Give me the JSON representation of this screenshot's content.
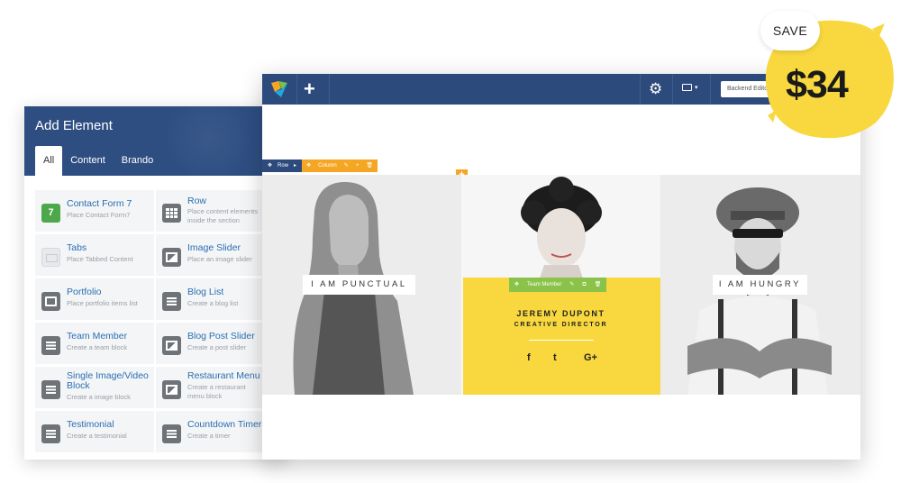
{
  "panel": {
    "title": "Add Element",
    "tabs": [
      "All",
      "Content",
      "Brando"
    ],
    "elements": [
      {
        "name": "Contact Form 7",
        "desc": "Place Contact Form7",
        "icon": "contact-form-icon"
      },
      {
        "name": "Row",
        "desc": "Place content elements inside the section",
        "icon": "row-grid-icon"
      },
      {
        "name": "Tabs",
        "desc": "Place Tabbed Content",
        "icon": "tabs-icon"
      },
      {
        "name": "Image Slider",
        "desc": "Place an image slider",
        "icon": "image-slider-icon"
      },
      {
        "name": "Portfolio",
        "desc": "Place portfolio items list",
        "icon": "portfolio-icon"
      },
      {
        "name": "Blog List",
        "desc": "Create a blog list",
        "icon": "blog-list-icon"
      },
      {
        "name": "Team Member",
        "desc": "Create a team block",
        "icon": "team-member-icon"
      },
      {
        "name": "Blog Post Slider",
        "desc": "Create a post slider",
        "icon": "blog-post-slider-icon"
      },
      {
        "name": "Single Image/Video Block",
        "desc": "Create a image block",
        "icon": "single-image-icon"
      },
      {
        "name": "Restaurant Menu",
        "desc": "Create a restaurant menu block",
        "icon": "restaurant-menu-icon"
      },
      {
        "name": "Testimonial",
        "desc": "Create a testimonial",
        "icon": "testimonial-icon"
      },
      {
        "name": "Countdown Timer",
        "desc": "Create a timer",
        "icon": "countdown-timer-icon"
      }
    ],
    "contact_icon_text": "7"
  },
  "editor": {
    "backend_button": "Backend Editor",
    "row_label": "Row",
    "column_label": "Column",
    "cards": [
      {
        "label": "I AM PUNCTUAL"
      },
      {
        "member_tag": "Team Member",
        "name": "JEREMY DUPONT",
        "role": "CREATIVE DIRECTOR",
        "social": [
          "f",
          "t",
          "G+"
        ]
      },
      {
        "label": "I AM HUNGRY"
      }
    ]
  },
  "badge": {
    "save": "SAVE",
    "price": "$34",
    "color": "#f8d83e"
  },
  "colors": {
    "toolbar": "#2d4a7c",
    "link": "#2a6fb0",
    "column_tag": "#f5a623",
    "member_tag": "#8bc34a",
    "member_bg": "#f8d83e"
  }
}
